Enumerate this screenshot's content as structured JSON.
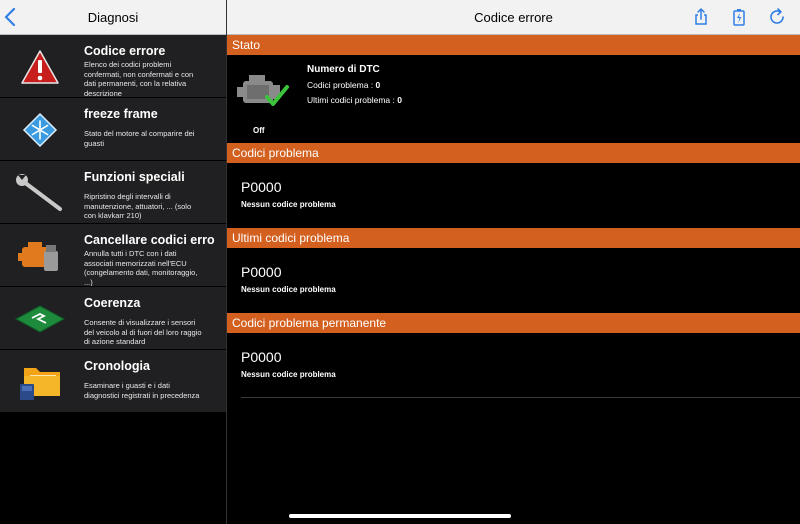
{
  "sidebar": {
    "title": "Diagnosi",
    "items": [
      {
        "title": "Codice errore",
        "desc": "Elenco dei codici problemi confermati, non confermati e con dati permanenti, con la relativa descrizione",
        "icon": "warning-icon"
      },
      {
        "title": "freeze frame",
        "desc": "Stato del motore al comparire dei guasti",
        "icon": "snowflake-icon"
      },
      {
        "title": "Funzioni speciali",
        "desc": "Ripristino degli intervalli di manutenzione, attuatori, ... (solo con klavkarr 210)",
        "icon": "wrench-icon"
      },
      {
        "title": "Cancellare codici erro",
        "desc": "Annulla tutti i DTC con i dati associati memorizzati nell'ECU (congelamento dati, monitoraggio, ...)",
        "icon": "engine-brush-icon"
      },
      {
        "title": "Coerenza",
        "desc": "Consente di visualizzare i sensori del veicolo al di fuori del loro raggio di azione standard",
        "icon": "coherence-icon"
      },
      {
        "title": "Cronologia",
        "desc": "Esaminare i guasti e i dati diagnostici registrati in precedenza",
        "icon": "folder-icon"
      }
    ]
  },
  "main": {
    "title": "Codice errore",
    "stato": {
      "section": "Stato",
      "heading": "Numero di DTC",
      "codes_label": "Codici problema : ",
      "codes_value": "0",
      "last_label": "Ultimi codici problema : ",
      "last_value": "0",
      "status": "Off"
    },
    "sections": [
      {
        "title": "Codici problema",
        "code": "P0000",
        "desc": "Nessun codice problema"
      },
      {
        "title": "Ultimi codici problema",
        "code": "P0000",
        "desc": "Nessun codice problema"
      },
      {
        "title": "Codici problema permanente",
        "code": "P0000",
        "desc": "Nessun codice problema"
      }
    ]
  },
  "colors": {
    "accent": "#d3601f",
    "header_bg": "#f2f2f2",
    "ios_blue": "#2f7ee6"
  }
}
